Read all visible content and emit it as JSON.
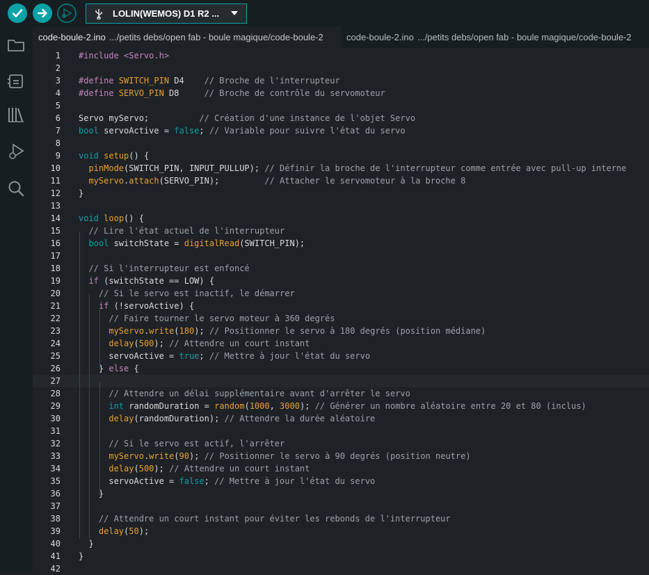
{
  "toolbar": {
    "board_name": "LOLIN(WEMOS) D1 R2 ...",
    "icons": [
      "verify-icon",
      "upload-icon",
      "debug-icon",
      "usb-icon",
      "chevron-down-icon"
    ]
  },
  "sidebar": {
    "items": [
      "folder-icon",
      "board-manager-icon",
      "library-icon",
      "debug-icon",
      "search-icon"
    ]
  },
  "tabs": [
    {
      "file": "code-boule-2.ino",
      "path": ".../petits debs/open fab - boule magique/code-boule-2",
      "active": true
    },
    {
      "file": "code-boule-2.ino",
      "path": ".../petits debs/open fab - boule magique/code-boule-2",
      "active": false
    }
  ],
  "editor": {
    "current_line": 27,
    "lines": [
      [
        [
          "pp",
          "#include <Servo.h>"
        ]
      ],
      [],
      [
        [
          "pp",
          "#define "
        ],
        [
          "df",
          "SWITCH_PIN"
        ],
        [
          "tx",
          " D4    "
        ],
        [
          "cm",
          "// Broche de l'interrupteur"
        ]
      ],
      [
        [
          "pp",
          "#define "
        ],
        [
          "df",
          "SERVO_PIN"
        ],
        [
          "tx",
          " D8     "
        ],
        [
          "cm",
          "// Broche de contrôle du servomoteur"
        ]
      ],
      [],
      [
        [
          "tx",
          "Servo myServo;          "
        ],
        [
          "cm",
          "// Création d'une instance de l'objet Servo"
        ]
      ],
      [
        [
          "ty",
          "bool"
        ],
        [
          "tx",
          " servoActive = "
        ],
        [
          "ty",
          "false"
        ],
        [
          "tx",
          "; "
        ],
        [
          "cm",
          "// Variable pour suivre l'état du servo"
        ]
      ],
      [],
      [
        [
          "ty",
          "void"
        ],
        [
          "tx",
          " "
        ],
        [
          "fn",
          "setup"
        ],
        [
          "tx",
          "() {"
        ]
      ],
      [
        [
          "tx",
          "  "
        ],
        [
          "fn",
          "pinMode"
        ],
        [
          "tx",
          "(SWITCH_PIN, INPUT_PULLUP); "
        ],
        [
          "cm",
          "// Définir la broche de l'interrupteur comme entrée avec pull-up interne"
        ]
      ],
      [
        [
          "tx",
          "  "
        ],
        [
          "fn",
          "myServo"
        ],
        [
          "tx",
          "."
        ],
        [
          "fn",
          "attach"
        ],
        [
          "tx",
          "(SERVO_PIN);         "
        ],
        [
          "cm",
          "// Attacher le servomoteur à la broche 8"
        ]
      ],
      [
        [
          "tx",
          "}"
        ]
      ],
      [],
      [
        [
          "ty",
          "void"
        ],
        [
          "tx",
          " "
        ],
        [
          "fn",
          "loop"
        ],
        [
          "tx",
          "() {"
        ]
      ],
      [
        [
          "tx",
          "  "
        ],
        [
          "cm",
          "// Lire l'état actuel de l'interrupteur"
        ]
      ],
      [
        [
          "tx",
          "  "
        ],
        [
          "ty",
          "bool"
        ],
        [
          "tx",
          " switchState = "
        ],
        [
          "fn",
          "digitalRead"
        ],
        [
          "tx",
          "(SWITCH_PIN);"
        ]
      ],
      [],
      [
        [
          "tx",
          "  "
        ],
        [
          "cm",
          "// Si l'interrupteur est enfoncé"
        ]
      ],
      [
        [
          "tx",
          "  "
        ],
        [
          "kw",
          "if"
        ],
        [
          "tx",
          " (switchState == LOW) {"
        ]
      ],
      [
        [
          "tx",
          "    "
        ],
        [
          "cm",
          "// Si le servo est inactif, le démarrer"
        ]
      ],
      [
        [
          "tx",
          "    "
        ],
        [
          "kw",
          "if"
        ],
        [
          "tx",
          " (!servoActive) {"
        ]
      ],
      [
        [
          "tx",
          "      "
        ],
        [
          "cm",
          "// Faire tourner le servo moteur à 360 degrés"
        ]
      ],
      [
        [
          "tx",
          "      "
        ],
        [
          "fn",
          "myServo"
        ],
        [
          "tx",
          "."
        ],
        [
          "fn",
          "write"
        ],
        [
          "tx",
          "("
        ],
        [
          "nu",
          "180"
        ],
        [
          "tx",
          "); "
        ],
        [
          "cm",
          "// Positionner le servo à 180 degrés (position médiane)"
        ]
      ],
      [
        [
          "tx",
          "      "
        ],
        [
          "fn",
          "delay"
        ],
        [
          "tx",
          "("
        ],
        [
          "nu",
          "500"
        ],
        [
          "tx",
          "); "
        ],
        [
          "cm",
          "// Attendre un court instant"
        ]
      ],
      [
        [
          "tx",
          "      servoActive = "
        ],
        [
          "ty",
          "true"
        ],
        [
          "tx",
          "; "
        ],
        [
          "cm",
          "// Mettre à jour l'état du servo"
        ]
      ],
      [
        [
          "tx",
          "    } "
        ],
        [
          "kw",
          "else"
        ],
        [
          "tx",
          " {"
        ]
      ],
      [],
      [
        [
          "tx",
          "      "
        ],
        [
          "cm",
          "// Attendre un délai supplémentaire avant d'arrêter le servo"
        ]
      ],
      [
        [
          "tx",
          "      "
        ],
        [
          "ty",
          "int"
        ],
        [
          "tx",
          " randomDuration = "
        ],
        [
          "fn",
          "random"
        ],
        [
          "tx",
          "("
        ],
        [
          "nu",
          "1000"
        ],
        [
          "tx",
          ", "
        ],
        [
          "nu",
          "3000"
        ],
        [
          "tx",
          "); "
        ],
        [
          "cm",
          "// Générer un nombre aléatoire entre 20 et 80 (inclus)"
        ]
      ],
      [
        [
          "tx",
          "      "
        ],
        [
          "fn",
          "delay"
        ],
        [
          "tx",
          "(randomDuration); "
        ],
        [
          "cm",
          "// Attendre la durée aléatoire"
        ]
      ],
      [],
      [
        [
          "tx",
          "      "
        ],
        [
          "cm",
          "// Si le servo est actif, l'arrêter"
        ]
      ],
      [
        [
          "tx",
          "      "
        ],
        [
          "fn",
          "myServo"
        ],
        [
          "tx",
          "."
        ],
        [
          "fn",
          "write"
        ],
        [
          "tx",
          "("
        ],
        [
          "nu",
          "90"
        ],
        [
          "tx",
          "); "
        ],
        [
          "cm",
          "// Positionner le servo à 90 degrés (position neutre)"
        ]
      ],
      [
        [
          "tx",
          "      "
        ],
        [
          "fn",
          "delay"
        ],
        [
          "tx",
          "("
        ],
        [
          "nu",
          "500"
        ],
        [
          "tx",
          "); "
        ],
        [
          "cm",
          "// Attendre un court instant"
        ]
      ],
      [
        [
          "tx",
          "      servoActive = "
        ],
        [
          "ty",
          "false"
        ],
        [
          "tx",
          "; "
        ],
        [
          "cm",
          "// Mettre à jour l'état du servo"
        ]
      ],
      [
        [
          "tx",
          "    }"
        ]
      ],
      [],
      [
        [
          "tx",
          "    "
        ],
        [
          "cm",
          "// Attendre un court instant pour éviter les rebonds de l'interrupteur"
        ]
      ],
      [
        [
          "tx",
          "    "
        ],
        [
          "fn",
          "delay"
        ],
        [
          "tx",
          "("
        ],
        [
          "nu",
          "50"
        ],
        [
          "tx",
          ");"
        ]
      ],
      [
        [
          "tx",
          "  }"
        ]
      ],
      [
        [
          "tx",
          "}"
        ]
      ],
      []
    ]
  }
}
